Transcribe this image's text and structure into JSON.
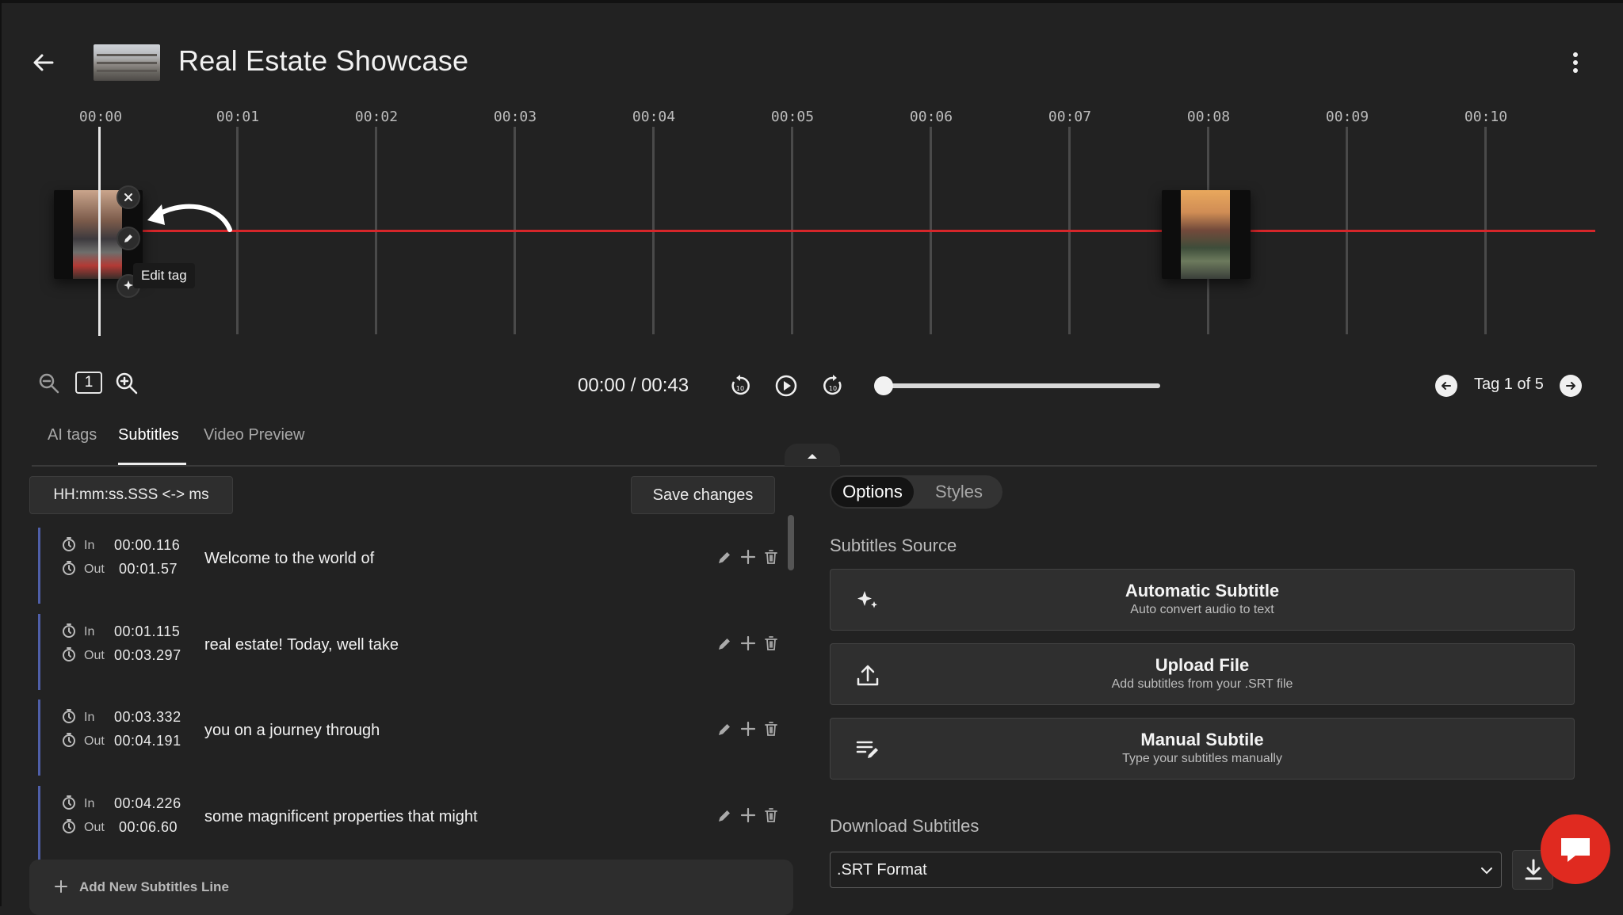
{
  "header": {
    "title": "Real Estate Showcase"
  },
  "timeline": {
    "ticks": [
      "00:00",
      "00:01",
      "00:02",
      "00:03",
      "00:04",
      "00:05",
      "00:06",
      "00:07",
      "00:08",
      "00:09",
      "00:10"
    ],
    "tooltip": "Edit tag",
    "accent_color": "#d6262a"
  },
  "controls": {
    "zoom_level": "1",
    "timecode": "00:00 / 00:43",
    "seek_progress": 0.0,
    "tag_counter": "Tag 1 of 5"
  },
  "tabs": [
    {
      "label": "AI tags",
      "active": false
    },
    {
      "label": "Subtitles",
      "active": true
    },
    {
      "label": "Video Preview",
      "active": false
    }
  ],
  "subtitles_panel": {
    "format_toggle": "HH:mm:ss.SSS <-> ms",
    "save_label": "Save changes",
    "in_label": "In",
    "out_label": "Out",
    "rows": [
      {
        "in": "00:00.116",
        "out": "00:01.57",
        "text": "Welcome to the world of"
      },
      {
        "in": "00:01.115",
        "out": "00:03.297",
        "text": "real estate! Today, well take"
      },
      {
        "in": "00:03.332",
        "out": "00:04.191",
        "text": "you on a journey through"
      },
      {
        "in": "00:04.226",
        "out": "00:06.60",
        "text": "some magnificent properties that might"
      }
    ],
    "add_line_label": "Add New Subtitles Line"
  },
  "options_panel": {
    "segments": [
      "Options",
      "Styles"
    ],
    "source_label": "Subtitles Source",
    "cards": [
      {
        "title": "Automatic Subtitle",
        "subtitle": "Auto convert audio to text",
        "icon": "sparkles-icon"
      },
      {
        "title": "Upload File",
        "subtitle": "Add subtitles from your .SRT file",
        "icon": "upload-icon"
      },
      {
        "title": "Manual Subtile",
        "subtitle": "Type your subtitles manually",
        "icon": "edit-lines-icon"
      }
    ],
    "download_label": "Download Subtitles",
    "download_format": ".SRT Format"
  }
}
